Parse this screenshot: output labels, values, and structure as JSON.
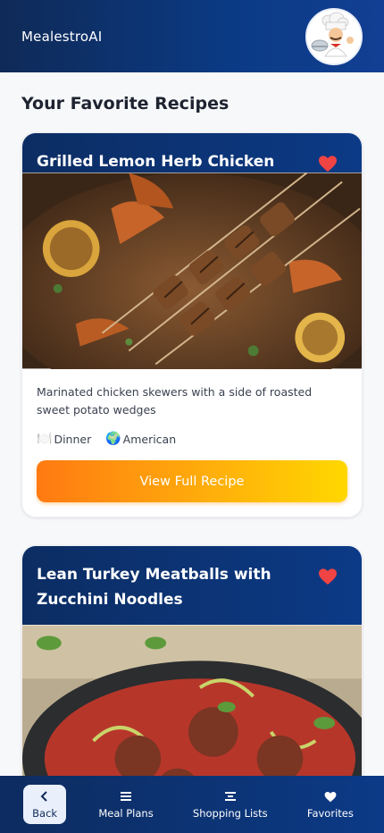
{
  "header": {
    "brand": "MealestroAI",
    "avatar_icon": "chef-avatar-icon"
  },
  "page": {
    "title": "Your Favorite Recipes"
  },
  "recipes": [
    {
      "title": "Grilled Lemon Herb Chicken Skewers",
      "favorite_icon": "heart-icon",
      "favorited": true,
      "description": "Marinated chicken skewers with a side of roasted sweet potato wedges",
      "meal_type_emoji": "🍽️",
      "meal_type": "Dinner",
      "cuisine_emoji": "🌍",
      "cuisine": "American",
      "cta_label": "View Full Recipe"
    },
    {
      "title": "Lean Turkey Meatballs with Zucchini Noodles",
      "favorite_icon": "heart-icon",
      "favorited": true
    }
  ],
  "nav": {
    "items": [
      {
        "label": "Back",
        "icon": "chevron-left-icon",
        "active": true
      },
      {
        "label": "Meal Plans",
        "icon": "menu-lines-icon",
        "active": false
      },
      {
        "label": "Shopping Lists",
        "icon": "list-icon",
        "active": false
      },
      {
        "label": "Favorites",
        "icon": "heart-icon",
        "active": false
      }
    ]
  },
  "colors": {
    "header_gradient_start": "#0f2a57",
    "header_gradient_end": "#123f93",
    "heart": "#f04343",
    "cta_start": "#ff7a12",
    "cta_end": "#ffd700"
  }
}
